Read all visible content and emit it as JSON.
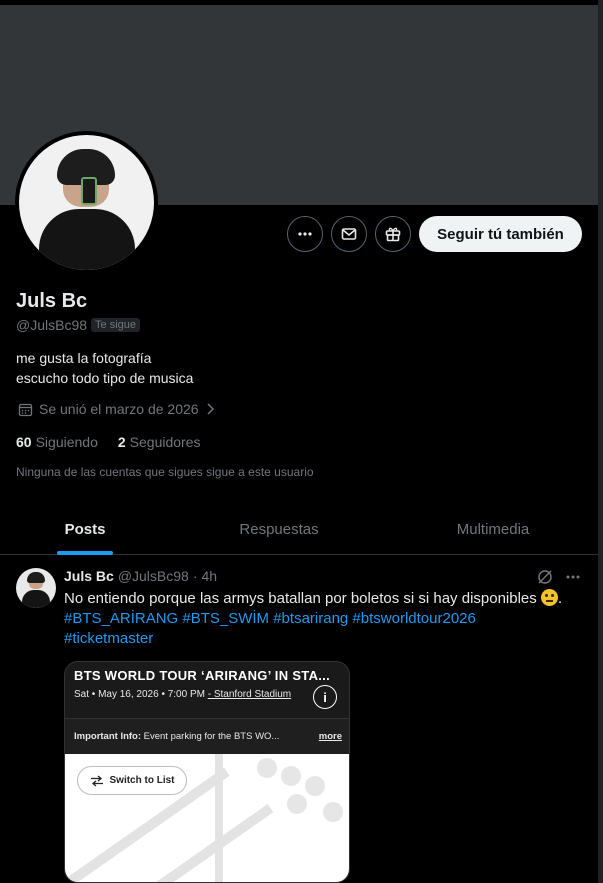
{
  "profile": {
    "name": "Juls Bc",
    "handle": "@JulsBc98",
    "follows_you_badge": "Te sigue",
    "bio_line1": "me gusta la fotografía",
    "bio_line2": "escucho todo tipo de musica",
    "joined": "Se unió el marzo de 2026",
    "following_count": "60",
    "following_label": "Siguiendo",
    "followers_count": "2",
    "followers_label": "Seguidores",
    "mutuals_note": "Ninguna de las cuentas que sigues sigue a este usuario"
  },
  "actions": {
    "more_icon": "more-horizontal-icon",
    "message_icon": "mail-icon",
    "gift_icon": "gift-icon",
    "follow_back_label": "Seguir tú también"
  },
  "tabs": [
    {
      "label": "Posts",
      "active": true
    },
    {
      "label": "Respuestas",
      "active": false
    },
    {
      "label": "Multimedia",
      "active": false
    }
  ],
  "post": {
    "author": "Juls Bc",
    "handle": "@JulsBc98",
    "dot": "·",
    "time": "4h",
    "text": "No entiendo porque las armys batallan por boletos si si hay disponibles",
    "hashtags_line1": "#BTS_ARİRANG #BTS_SWİM #btsarirang #btsworldtour2026",
    "hashtags_line2": "#ticketmaster",
    "card": {
      "title": "BTS WORLD TOUR ‘ARIRANG’ IN STA...",
      "date": "Sat • May 16, 2026 • 7:00 PM",
      "venue": "- Stanford Stadium",
      "info_label": "Important Info:",
      "info_text": "Event parking for the BTS WO...",
      "more": "more",
      "switch_label": "Switch to List"
    }
  },
  "colors": {
    "background": "#000000",
    "banner": "#333639",
    "accent": "#1d9bf0",
    "muted": "#71767b",
    "text": "#e7e9ea"
  }
}
